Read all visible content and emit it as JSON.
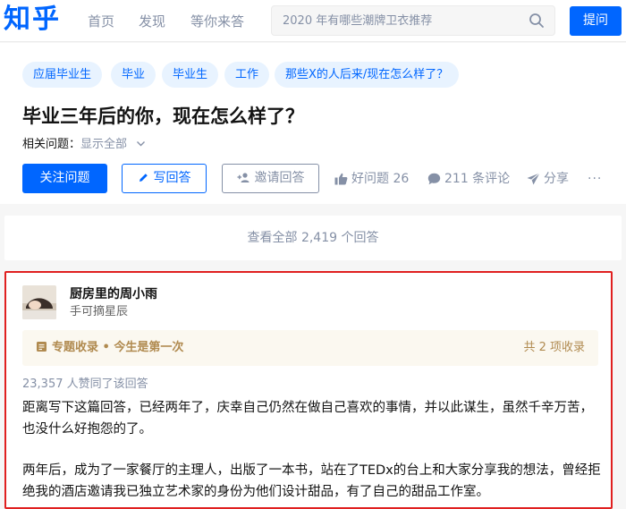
{
  "header": {
    "logo": "知乎",
    "nav": [
      "首页",
      "发现",
      "等你来答"
    ],
    "search_placeholder": "2020 年有哪些潮牌卫衣推荐",
    "ask_label": "提问"
  },
  "question": {
    "topics": [
      "应届毕业生",
      "毕业",
      "毕业生",
      "工作",
      "那些X的人后来/现在怎么样了？"
    ],
    "title": "毕业三年后的你，现在怎么样了？",
    "related_label": "相关问题：",
    "related_show_all": "显示全部",
    "follow_label": "关注问题",
    "write_answer_label": "写回答",
    "invite_label": "邀请回答",
    "good_question_label": "好问题 26",
    "comments_label": "211 条评论",
    "share_label": "分享",
    "more_label": "···"
  },
  "view_all_answers": "查看全部 2,419 个回答",
  "answer": {
    "author_name": "厨房里的周小雨",
    "author_bio": "手可摘星辰",
    "collection_left": "专题收录 • 今生是第一次",
    "collection_right": "共 2 项收录",
    "votes": "23,357 人赞同了该回答",
    "paragraph1": "距离写下这篇回答，已经两年了，庆幸自己仍然在做自己喜欢的事情，并以此谋生，虽然千辛万苦，也没什么好抱怨的了。",
    "paragraph2": "两年后，成为了一家餐厅的主理人，出版了一本书，站在了TEDx的台上和大家分享我的想法，曾经拒绝我的酒店邀请我已独立艺术家的身份为他们设计甜品，有了自己的甜品工作室。"
  },
  "colors": {
    "brand": "#0066ff",
    "highlight_border": "#e02020",
    "collection_text": "#b08a4f"
  }
}
